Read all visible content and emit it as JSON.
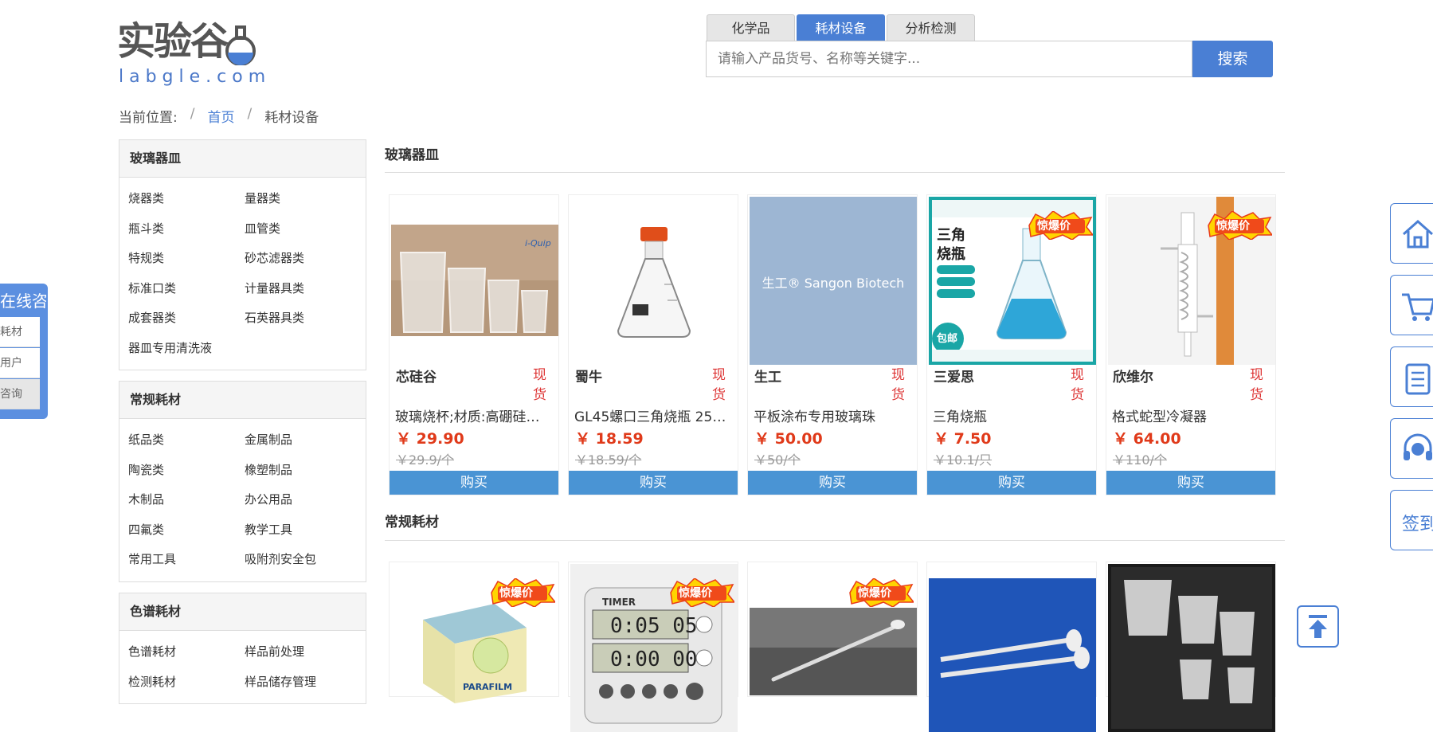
{
  "logo": {
    "cn": "实验谷",
    "en": "labgle.com"
  },
  "search": {
    "tabs": [
      "化学品",
      "耗材设备",
      "分析检测"
    ],
    "active_tab": 1,
    "placeholder": "请输入产品货号、名称等关键字...",
    "button": "搜索"
  },
  "breadcrumb": {
    "label": "当前位置:",
    "sep": "/",
    "home": "首页",
    "current": "耗材设备"
  },
  "sidebar": [
    {
      "title": "玻璃器皿",
      "items": [
        "烧器类",
        "量器类",
        "瓶斗类",
        "皿管类",
        "特规类",
        "砂芯滤器类",
        "标准口类",
        "计量器具类",
        "成套器类",
        "石英器具类",
        "器皿专用清洗液"
      ]
    },
    {
      "title": "常规耗材",
      "items": [
        "纸品类",
        "金属制品",
        "陶瓷类",
        "橡塑制品",
        "木制品",
        "办公用品",
        "四氟类",
        "教学工具",
        "常用工具",
        "吸附剂安全包"
      ]
    },
    {
      "title": "色谱耗材",
      "items": [
        "色谱耗材",
        "样品前处理",
        "检测耗材",
        "样品储存管理"
      ]
    }
  ],
  "sections": [
    {
      "title": "玻璃器皿",
      "products": [
        {
          "brand": "芯硅谷",
          "stock": "现货",
          "name": "玻璃烧杯;材质:高硼硅…",
          "price": "￥ 29.90",
          "old": "￥29.9/个",
          "buy": "购买",
          "img": "beakers"
        },
        {
          "brand": "蜀牛",
          "stock": "现货",
          "name": "GL45螺口三角烧瓶 250…",
          "price": "￥ 18.59",
          "old": "￥18.59/个",
          "buy": "购买",
          "img": "flask-orange"
        },
        {
          "brand": "生工",
          "stock": "现货",
          "name": "平板涂布专用玻璃珠",
          "price": "￥ 50.00",
          "old": "￥50/个",
          "buy": "购买",
          "img": "sangon",
          "img_text": "生工® Sangon Biotech"
        },
        {
          "brand": "三爱思",
          "stock": "现货",
          "name": "三角烧瓶",
          "price": "￥ 7.50",
          "old": "￥10.1/只",
          "buy": "购买",
          "img": "flask-blue",
          "badge": "惊爆价"
        },
        {
          "brand": "欣维尔",
          "stock": "现货",
          "name": "格式蛇型冷凝器",
          "price": "￥ 64.00",
          "old": "￥110/个",
          "buy": "购买",
          "img": "condenser",
          "badge": "惊爆价"
        }
      ]
    },
    {
      "title": "常规耗材",
      "products": [
        {
          "img": "parafilm",
          "badge": "惊爆价",
          "img_text": "PARAFILM"
        },
        {
          "img": "timer",
          "badge": "惊爆价",
          "img_text": "TIMER",
          "timer_top": "0:05 05",
          "timer_bottom": "0:00 00"
        },
        {
          "img": "spatula",
          "badge": "惊爆价"
        },
        {
          "img": "stirrer"
        },
        {
          "img": "plastic-beakers"
        }
      ]
    }
  ],
  "consult": {
    "title": "在线咨询",
    "rows": [
      "耗材",
      "用户",
      "咨询"
    ]
  },
  "right_toolbar": {
    "sign_label": "签到"
  },
  "colors": {
    "accent": "#4a7fd4",
    "price": "#e03a1a",
    "buy": "#4a94d4"
  }
}
